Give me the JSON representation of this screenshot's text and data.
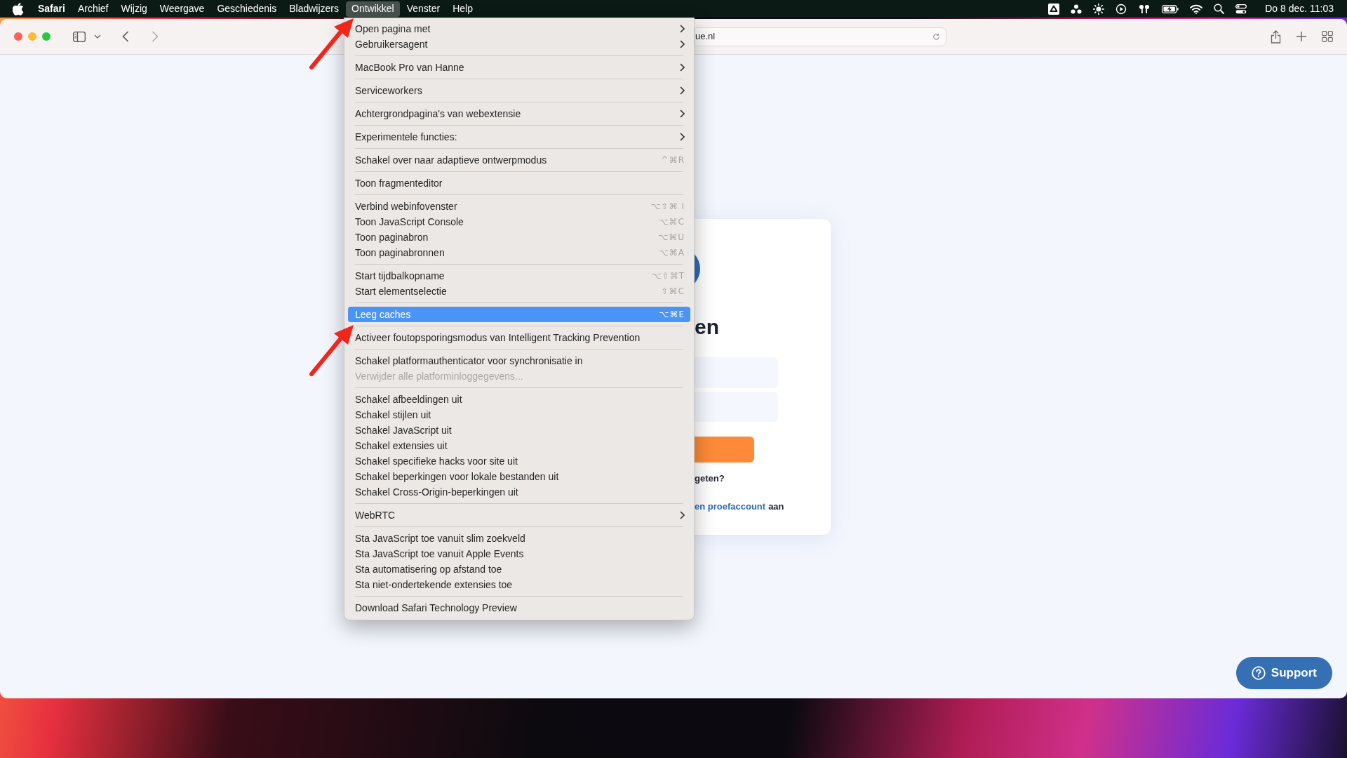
{
  "menu_bar": {
    "items": [
      {
        "label": "Safari",
        "kind": "app",
        "selected": false
      },
      {
        "label": "Archief",
        "kind": "menu",
        "selected": false
      },
      {
        "label": "Wijzig",
        "kind": "menu",
        "selected": false
      },
      {
        "label": "Weergave",
        "kind": "menu",
        "selected": false
      },
      {
        "label": "Geschiedenis",
        "kind": "menu",
        "selected": false
      },
      {
        "label": "Bladwijzers",
        "kind": "menu",
        "selected": false
      },
      {
        "label": "Ontwikkel",
        "kind": "menu",
        "selected": true
      },
      {
        "label": "Venster",
        "kind": "menu",
        "selected": false
      },
      {
        "label": "Help",
        "kind": "menu",
        "selected": false
      }
    ],
    "clock": "Do 8 dec. 11:03"
  },
  "browser": {
    "address": "ue.nl"
  },
  "menu": {
    "groups": [
      [
        {
          "label": "Open pagina met",
          "submenu": true,
          "selected": false,
          "disabled": false
        },
        {
          "label": "Gebruikersagent",
          "submenu": true,
          "selected": false,
          "disabled": false
        }
      ],
      [
        {
          "label": "MacBook Pro van Hanne",
          "submenu": true,
          "selected": false,
          "disabled": false
        }
      ],
      [
        {
          "label": "Serviceworkers",
          "submenu": true,
          "selected": false,
          "disabled": false
        }
      ],
      [
        {
          "label": "Achtergrondpagina's van webextensie",
          "submenu": true,
          "selected": false,
          "disabled": false
        }
      ],
      [
        {
          "label": "Experimentele functies:",
          "submenu": true,
          "selected": false,
          "disabled": false
        }
      ],
      [
        {
          "label": "Schakel over naar adaptieve ontwerpmodus",
          "shortcut": "^⌘R",
          "submenu": false,
          "selected": false,
          "disabled": false
        }
      ],
      [
        {
          "label": "Toon fragmenteditor",
          "submenu": false,
          "selected": false,
          "disabled": false
        }
      ],
      [
        {
          "label": "Verbind webinfovenster",
          "shortcut": "⌥⇧⌘ I",
          "submenu": false,
          "selected": false,
          "disabled": false
        },
        {
          "label": "Toon JavaScript Console",
          "shortcut": "⌥⌘C",
          "submenu": false,
          "selected": false,
          "disabled": false
        },
        {
          "label": "Toon paginabron",
          "shortcut": "⌥⌘U",
          "submenu": false,
          "selected": false,
          "disabled": false
        },
        {
          "label": "Toon paginabronnen",
          "shortcut": "⌥⌘A",
          "submenu": false,
          "selected": false,
          "disabled": false
        }
      ],
      [
        {
          "label": "Start tijdbalkopname",
          "shortcut": "⌥⇧⌘T",
          "submenu": false,
          "selected": false,
          "disabled": false
        },
        {
          "label": "Start elementselectie",
          "shortcut": "⇧⌘C",
          "submenu": false,
          "selected": false,
          "disabled": false
        }
      ],
      [
        {
          "label": "Leeg caches",
          "shortcut": "⌥⌘E",
          "submenu": false,
          "selected": true,
          "disabled": false
        }
      ],
      [
        {
          "label": "Activeer foutopsporingsmodus van Intelligent Tracking Prevention",
          "submenu": false,
          "selected": false,
          "disabled": false
        }
      ],
      [
        {
          "label": "Schakel platformauthenticator voor synchronisatie in",
          "submenu": false,
          "selected": false,
          "disabled": false
        },
        {
          "label": "Verwijder alle platforminloggegevens...",
          "submenu": false,
          "selected": false,
          "disabled": true
        }
      ],
      [
        {
          "label": "Schakel afbeeldingen uit",
          "submenu": false,
          "selected": false,
          "disabled": false
        },
        {
          "label": "Schakel stijlen uit",
          "submenu": false,
          "selected": false,
          "disabled": false
        },
        {
          "label": "Schakel JavaScript uit",
          "submenu": false,
          "selected": false,
          "disabled": false
        },
        {
          "label": "Schakel extensies uit",
          "submenu": false,
          "selected": false,
          "disabled": false
        },
        {
          "label": "Schakel specifieke hacks voor site uit",
          "submenu": false,
          "selected": false,
          "disabled": false
        },
        {
          "label": "Schakel beperkingen voor lokale bestanden uit",
          "submenu": false,
          "selected": false,
          "disabled": false
        },
        {
          "label": "Schakel Cross-Origin-beperkingen uit",
          "submenu": false,
          "selected": false,
          "disabled": false
        }
      ],
      [
        {
          "label": "WebRTC",
          "submenu": true,
          "selected": false,
          "disabled": false
        }
      ],
      [
        {
          "label": "Sta JavaScript toe vanuit slim zoekveld",
          "submenu": false,
          "selected": false,
          "disabled": false
        },
        {
          "label": "Sta JavaScript toe vanuit Apple Events",
          "submenu": false,
          "selected": false,
          "disabled": false
        },
        {
          "label": "Sta automatisering op afstand toe",
          "submenu": false,
          "selected": false,
          "disabled": false
        },
        {
          "label": "Sta niet-ondertekende extensies toe",
          "submenu": false,
          "selected": false,
          "disabled": false
        }
      ],
      [
        {
          "label": "Download Safari Technology Preview",
          "submenu": false,
          "selected": false,
          "disabled": false
        }
      ]
    ]
  },
  "page": {
    "heading": "en",
    "forgot_text": "geten?",
    "signup_link": "en proefaccount",
    "signup_suffix": "aan",
    "support_button": "Support"
  }
}
